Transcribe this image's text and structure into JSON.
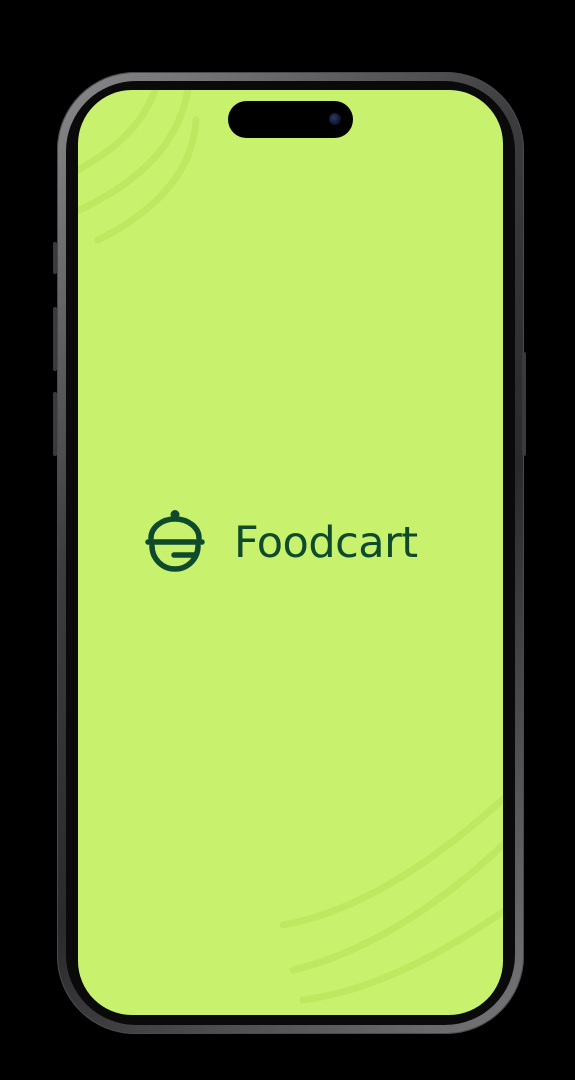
{
  "app": {
    "brand_name": "Foodcart",
    "logo_icon": "cloche-icon"
  },
  "colors": {
    "screen_background": "#c8f26e",
    "brand": "#0f4a2c",
    "device_frame": "#2a2a2c",
    "page_background": "#000000"
  }
}
